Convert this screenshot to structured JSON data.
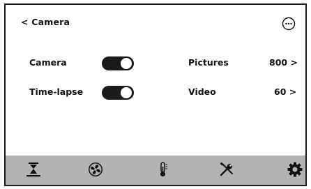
{
  "header": {
    "back_label": "< Camera",
    "menu_icon": "more-options-icon"
  },
  "settings": {
    "camera_label": "Camera",
    "camera_toggle_on": true,
    "timelapse_label": "Time-lapse",
    "timelapse_toggle_on": true,
    "pictures_label": "Pictures",
    "pictures_value": "800 >",
    "video_label": "Video",
    "video_value": "60 >"
  },
  "bottom_nav": {
    "items": [
      "print-bed-icon",
      "fan-icon",
      "thermometer-icon",
      "tools-icon",
      "settings-gear-icon"
    ]
  },
  "colors": {
    "toggle_on": "#1a1a1a",
    "bottom_bar": "#b3b3b3",
    "border": "#1a1a1a"
  }
}
